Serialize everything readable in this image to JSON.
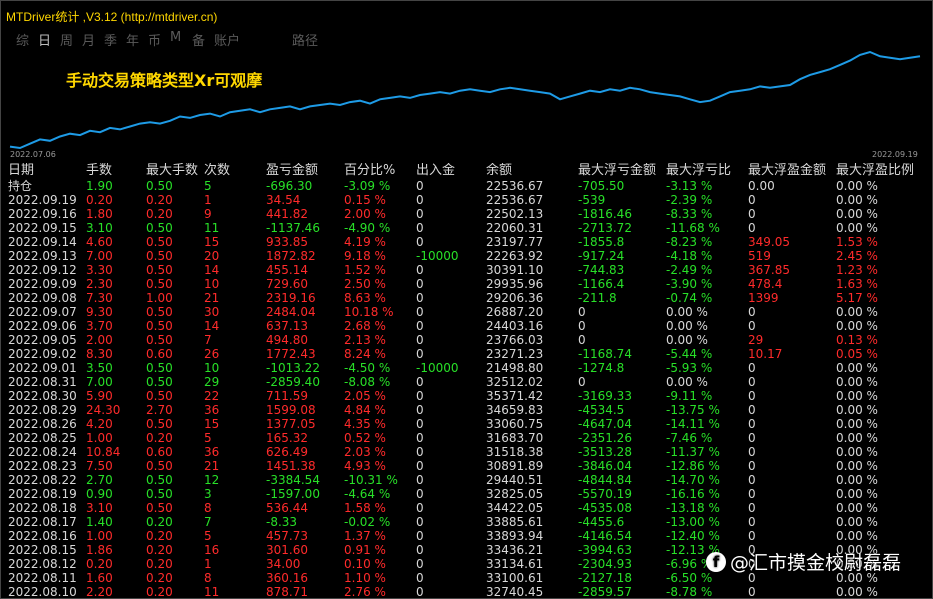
{
  "window": {
    "title": "MTDriver统计 ,V3.12 (http://mtdriver.cn)"
  },
  "tabs": [
    {
      "label": "综",
      "active": false
    },
    {
      "label": "日",
      "active": true
    },
    {
      "label": "周",
      "active": false
    },
    {
      "label": "月",
      "active": false
    },
    {
      "label": "季",
      "active": false
    },
    {
      "label": "年",
      "active": false
    },
    {
      "label": "币",
      "active": false
    },
    {
      "label": "M",
      "active": false
    },
    {
      "label": "备",
      "active": false
    },
    {
      "label": "账户",
      "active": false
    }
  ],
  "tab_extra": "路径",
  "chart_overlay_text": "手动交易策略类型Xr可观摩",
  "chart_dates": {
    "start": "2022.07.06",
    "end": "2022.09.19"
  },
  "colors": {
    "title": "#ffd700",
    "loss": "#ff2b2b",
    "gain": "#28e028",
    "curve": "#1e9be6"
  },
  "chart_data": {
    "type": "line",
    "x_range": [
      "2022.07.06",
      "2022.09.19"
    ],
    "series": [
      {
        "values": [
          20,
          19,
          22,
          25,
          24,
          27,
          29,
          28,
          31,
          30,
          33,
          32,
          34,
          36,
          37,
          36,
          38,
          41,
          40,
          42,
          43,
          41,
          44,
          45,
          46,
          44,
          46,
          47,
          48,
          46,
          48,
          49,
          50,
          49,
          51,
          52,
          50,
          53,
          54,
          55,
          54,
          56,
          57,
          58,
          57,
          59,
          60,
          59,
          58,
          60,
          61,
          60,
          59,
          58,
          57,
          53,
          55,
          57,
          59,
          58,
          60,
          59,
          61,
          60,
          58,
          57,
          56,
          55,
          53,
          51,
          52,
          55,
          58,
          59,
          60,
          62,
          61,
          62,
          63,
          67,
          70,
          72,
          74,
          77,
          80,
          84,
          86,
          83,
          82,
          81,
          82,
          83
        ]
      }
    ]
  },
  "table": {
    "columns": [
      "日期",
      "手数",
      "最大手数",
      "次数",
      "盈亏金额",
      "百分比%",
      "出入金",
      "余额",
      "最大浮亏金额",
      "最大浮亏比",
      "最大浮盈金额",
      "最大浮盈比例"
    ],
    "rows": [
      {
        "c": [
          "持仓",
          "1.90",
          "0.50",
          "5",
          "-696.30",
          "-3.09 %",
          "0",
          "22536.67",
          "-705.50",
          "-3.13 %",
          "0.00",
          "0.00 %"
        ],
        "t": "h"
      },
      {
        "c": [
          "2022.09.19",
          "0.20",
          "0.20",
          "1",
          "34.54",
          "0.15 %",
          "0",
          "22536.67",
          "-539",
          "-2.39 %",
          "0",
          "0.00 %"
        ],
        "t": "p"
      },
      {
        "c": [
          "2022.09.16",
          "1.80",
          "0.20",
          "9",
          "441.82",
          "2.00 %",
          "0",
          "22502.13",
          "-1816.46",
          "-8.33 %",
          "0",
          "0.00 %"
        ],
        "t": "p"
      },
      {
        "c": [
          "2022.09.15",
          "3.10",
          "0.50",
          "11",
          "-1137.46",
          "-4.90 %",
          "0",
          "22060.31",
          "-2713.72",
          "-11.68 %",
          "0",
          "0.00 %"
        ],
        "t": "n"
      },
      {
        "c": [
          "2022.09.14",
          "4.60",
          "0.50",
          "15",
          "933.85",
          "4.19 %",
          "0",
          "23197.77",
          "-1855.8",
          "-8.23 %",
          "349.05",
          "1.53 %"
        ],
        "t": "p"
      },
      {
        "c": [
          "2022.09.13",
          "7.00",
          "0.50",
          "20",
          "1872.82",
          "9.18 %",
          "-10000",
          "22263.92",
          "-917.24",
          "-4.18 %",
          "519",
          "2.45 %"
        ],
        "t": "p"
      },
      {
        "c": [
          "2022.09.12",
          "3.30",
          "0.50",
          "14",
          "455.14",
          "1.52 %",
          "0",
          "30391.10",
          "-744.83",
          "-2.49 %",
          "367.85",
          "1.23 %"
        ],
        "t": "p"
      },
      {
        "c": [
          "2022.09.09",
          "2.30",
          "0.50",
          "10",
          "729.60",
          "2.50 %",
          "0",
          "29935.96",
          "-1166.4",
          "-3.90 %",
          "478.4",
          "1.63 %"
        ],
        "t": "p"
      },
      {
        "c": [
          "2022.09.08",
          "7.30",
          "1.00",
          "21",
          "2319.16",
          "8.63 %",
          "0",
          "29206.36",
          "-211.8",
          "-0.74 %",
          "1399",
          "5.17 %"
        ],
        "t": "p"
      },
      {
        "c": [
          "2022.09.07",
          "9.30",
          "0.50",
          "30",
          "2484.04",
          "10.18 %",
          "0",
          "26887.20",
          "0",
          "0.00 %",
          "0",
          "0.00 %"
        ],
        "t": "p"
      },
      {
        "c": [
          "2022.09.06",
          "3.70",
          "0.50",
          "14",
          "637.13",
          "2.68 %",
          "0",
          "24403.16",
          "0",
          "0.00 %",
          "0",
          "0.00 %"
        ],
        "t": "p"
      },
      {
        "c": [
          "2022.09.05",
          "2.00",
          "0.50",
          "7",
          "494.80",
          "2.13 %",
          "0",
          "23766.03",
          "0",
          "0.00 %",
          "29",
          "0.13 %"
        ],
        "t": "p"
      },
      {
        "c": [
          "2022.09.02",
          "8.30",
          "0.60",
          "26",
          "1772.43",
          "8.24 %",
          "0",
          "23271.23",
          "-1168.74",
          "-5.44 %",
          "10.17",
          "0.05 %"
        ],
        "t": "p"
      },
      {
        "c": [
          "2022.09.01",
          "3.50",
          "0.50",
          "10",
          "-1013.22",
          "-4.50 %",
          "-10000",
          "21498.80",
          "-1274.8",
          "-5.93 %",
          "0",
          "0.00 %"
        ],
        "t": "n"
      },
      {
        "c": [
          "2022.08.31",
          "7.00",
          "0.50",
          "29",
          "-2859.40",
          "-8.08 %",
          "0",
          "32512.02",
          "0",
          "0.00 %",
          "0",
          "0.00 %"
        ],
        "t": "n"
      },
      {
        "c": [
          "2022.08.30",
          "5.90",
          "0.50",
          "22",
          "711.59",
          "2.05 %",
          "0",
          "35371.42",
          "-3169.33",
          "-9.11 %",
          "0",
          "0.00 %"
        ],
        "t": "p"
      },
      {
        "c": [
          "2022.08.29",
          "24.30",
          "2.70",
          "36",
          "1599.08",
          "4.84 %",
          "0",
          "34659.83",
          "-4534.5",
          "-13.75 %",
          "0",
          "0.00 %"
        ],
        "t": "p"
      },
      {
        "c": [
          "2022.08.26",
          "4.20",
          "0.50",
          "15",
          "1377.05",
          "4.35 %",
          "0",
          "33060.75",
          "-4647.04",
          "-14.11 %",
          "0",
          "0.00 %"
        ],
        "t": "p"
      },
      {
        "c": [
          "2022.08.25",
          "1.00",
          "0.20",
          "5",
          "165.32",
          "0.52 %",
          "0",
          "31683.70",
          "-2351.26",
          "-7.46 %",
          "0",
          "0.00 %"
        ],
        "t": "p"
      },
      {
        "c": [
          "2022.08.24",
          "10.84",
          "0.60",
          "36",
          "626.49",
          "2.03 %",
          "0",
          "31518.38",
          "-3513.28",
          "-11.37 %",
          "0",
          "0.00 %"
        ],
        "t": "p"
      },
      {
        "c": [
          "2022.08.23",
          "7.50",
          "0.50",
          "21",
          "1451.38",
          "4.93 %",
          "0",
          "30891.89",
          "-3846.04",
          "-12.86 %",
          "0",
          "0.00 %"
        ],
        "t": "p"
      },
      {
        "c": [
          "2022.08.22",
          "2.70",
          "0.50",
          "12",
          "-3384.54",
          "-10.31 %",
          "0",
          "29440.51",
          "-4844.84",
          "-14.70 %",
          "0",
          "0.00 %"
        ],
        "t": "n"
      },
      {
        "c": [
          "2022.08.19",
          "0.90",
          "0.50",
          "3",
          "-1597.00",
          "-4.64 %",
          "0",
          "32825.05",
          "-5570.19",
          "-16.16 %",
          "0",
          "0.00 %"
        ],
        "t": "n"
      },
      {
        "c": [
          "2022.08.18",
          "3.10",
          "0.50",
          "8",
          "536.44",
          "1.58 %",
          "0",
          "34422.05",
          "-4535.08",
          "-13.18 %",
          "0",
          "0.00 %"
        ],
        "t": "p"
      },
      {
        "c": [
          "2022.08.17",
          "1.40",
          "0.20",
          "7",
          "-8.33",
          "-0.02 %",
          "0",
          "33885.61",
          "-4455.6",
          "-13.00 %",
          "0",
          "0.00 %"
        ],
        "t": "n"
      },
      {
        "c": [
          "2022.08.16",
          "1.00",
          "0.20",
          "5",
          "457.73",
          "1.37 %",
          "0",
          "33893.94",
          "-4146.54",
          "-12.40 %",
          "0",
          "0.00 %"
        ],
        "t": "p"
      },
      {
        "c": [
          "2022.08.15",
          "1.86",
          "0.20",
          "16",
          "301.60",
          "0.91 %",
          "0",
          "33436.21",
          "-3994.63",
          "-12.13 %",
          "0",
          "0.00 %"
        ],
        "t": "p"
      },
      {
        "c": [
          "2022.08.12",
          "0.20",
          "0.20",
          "1",
          "34.00",
          "0.10 %",
          "0",
          "33134.61",
          "-2304.93",
          "-6.96 %",
          "0",
          "0.00 %"
        ],
        "t": "p"
      },
      {
        "c": [
          "2022.08.11",
          "1.60",
          "0.20",
          "8",
          "360.16",
          "1.10 %",
          "0",
          "33100.61",
          "-2127.18",
          "-6.50 %",
          "0",
          "0.00 %"
        ],
        "t": "p"
      },
      {
        "c": [
          "2022.08.10",
          "2.20",
          "0.20",
          "11",
          "878.71",
          "2.76 %",
          "0",
          "32740.45",
          "-2859.57",
          "-8.78 %",
          "0",
          "0.00 %"
        ],
        "t": "p"
      }
    ]
  },
  "watermark": {
    "icon": "facebook-icon",
    "text": "@汇市摸金校尉磊磊"
  }
}
